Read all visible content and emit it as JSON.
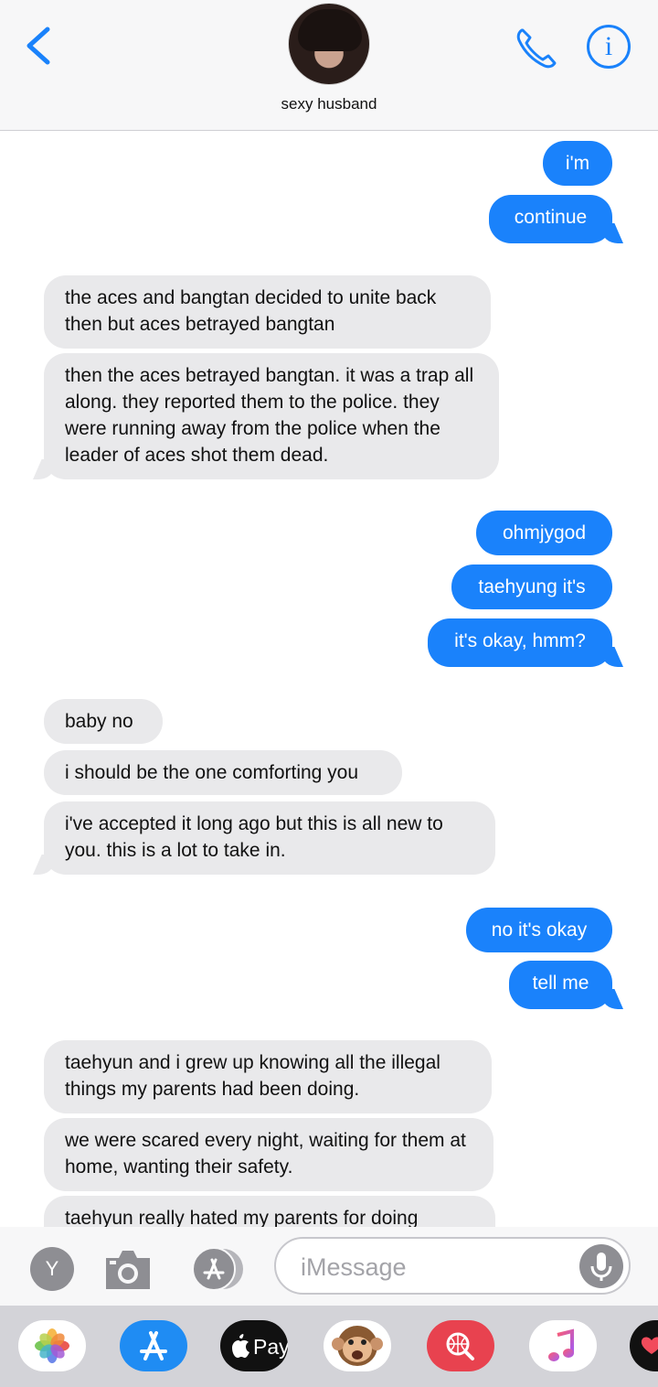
{
  "header": {
    "contact_name": "sexy husband"
  },
  "messages": [
    {
      "dir": "out",
      "text": "i'm",
      "tail": false,
      "l": 594,
      "t": 10,
      "w": 76,
      "h": 49
    },
    {
      "dir": "out",
      "text": "continue",
      "tail": true,
      "l": 535,
      "t": 69,
      "w": 135,
      "h": 53
    },
    {
      "dir": "in",
      "text": "the aces and bangtan decided to unite back then but aces betrayed bangtan",
      "tail": false,
      "l": 48,
      "t": 157,
      "w": 489,
      "h": 80
    },
    {
      "dir": "in",
      "text": "then the aces betrayed bangtan. it was a trap all along. they reported them to the police. they were running away from the police when the leader of aces shot them dead.",
      "tail": true,
      "l": 48,
      "t": 242,
      "w": 498,
      "h": 138
    },
    {
      "dir": "out",
      "text": "ohmjygod",
      "tail": false,
      "l": 521,
      "t": 414,
      "w": 149,
      "h": 49
    },
    {
      "dir": "out",
      "text": "taehyung it's",
      "tail": false,
      "l": 494,
      "t": 473,
      "w": 176,
      "h": 49
    },
    {
      "dir": "out",
      "text": "it's okay, hmm?",
      "tail": true,
      "l": 468,
      "t": 532,
      "w": 202,
      "h": 53
    },
    {
      "dir": "in",
      "text": "baby no",
      "tail": false,
      "l": 48,
      "t": 620,
      "w": 130,
      "h": 49
    },
    {
      "dir": "in",
      "text": "i should be the one comforting you",
      "tail": false,
      "l": 48,
      "t": 676,
      "w": 392,
      "h": 49
    },
    {
      "dir": "in",
      "text": "i've accepted it long ago but this is all new to you. this is a lot to take in.",
      "tail": true,
      "l": 48,
      "t": 732,
      "w": 494,
      "h": 80
    },
    {
      "dir": "out",
      "text": "no it's okay",
      "tail": false,
      "l": 510,
      "t": 848,
      "w": 160,
      "h": 49
    },
    {
      "dir": "out",
      "text": "tell me",
      "tail": true,
      "l": 557,
      "t": 906,
      "w": 113,
      "h": 53
    },
    {
      "dir": "in",
      "text": "taehyun and i grew up knowing all the illegal things my parents had been doing.",
      "tail": false,
      "l": 48,
      "t": 993,
      "w": 490,
      "h": 80
    },
    {
      "dir": "in",
      "text": "we were scared every night, waiting for them at home, wanting their safety.",
      "tail": false,
      "l": 48,
      "t": 1078,
      "w": 492,
      "h": 80
    },
    {
      "dir": "in",
      "text": "taehyun really hated my parents for doing",
      "tail": false,
      "l": 48,
      "t": 1163,
      "w": 494,
      "h": 80
    }
  ],
  "input": {
    "y_button_label": "Y",
    "placeholder": "iMessage"
  },
  "apps": [
    {
      "name": "photos-app-icon"
    },
    {
      "name": "app-store-app-icon"
    },
    {
      "name": "apple-pay-app-icon",
      "label": "Pay"
    },
    {
      "name": "animoji-app-icon"
    },
    {
      "name": "search-images-app-icon"
    },
    {
      "name": "music-app-icon"
    },
    {
      "name": "digital-touch-app-icon"
    }
  ],
  "colors": {
    "accent": "#1a82fb",
    "incoming_bubble": "#e9e9eb",
    "header_bg": "#f7f7f8",
    "drawer_bg": "#d3d3d8"
  }
}
